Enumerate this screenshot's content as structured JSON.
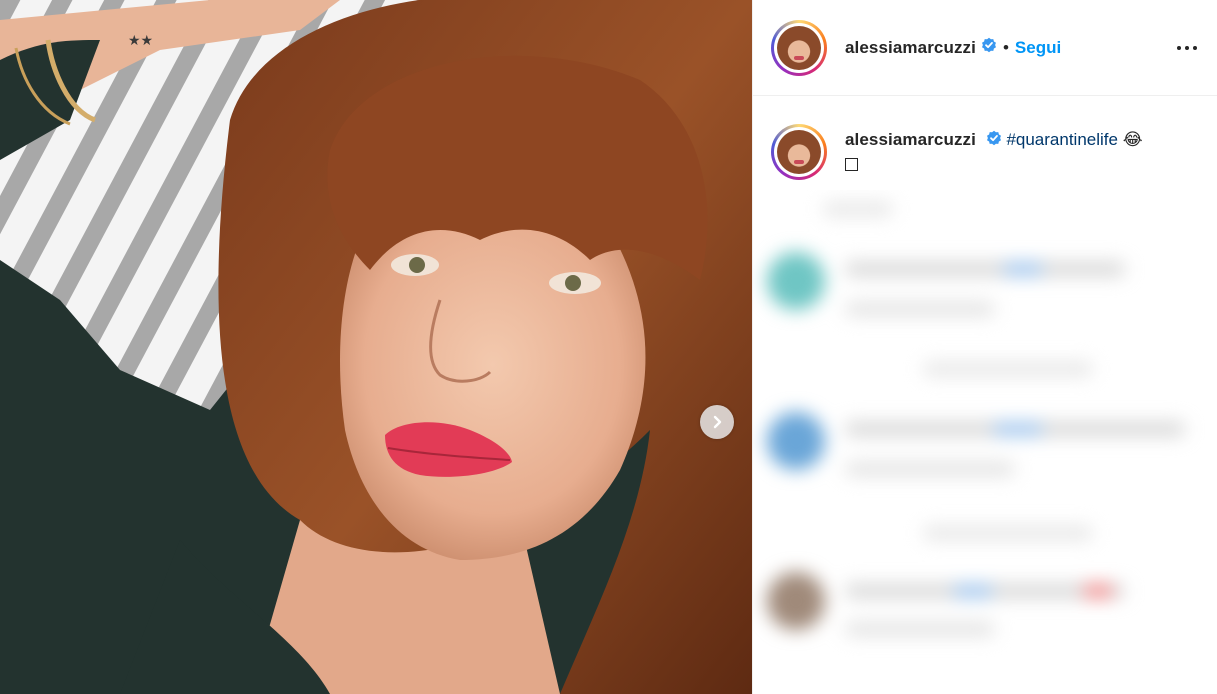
{
  "post": {
    "username": "alessiamarcuzzi",
    "follow_label": "Segui",
    "separator": "•",
    "caption": {
      "username": "alessiamarcuzzi",
      "hashtag": "#quarantinelife",
      "emoji": "😂"
    }
  },
  "icons": {
    "verified": "verified-badge-icon",
    "more": "more-options-icon",
    "next": "chevron-right-icon"
  },
  "colors": {
    "accent": "#0095f6",
    "hashtag": "#00376b",
    "verified": "#3897f0",
    "text": "#262626"
  }
}
